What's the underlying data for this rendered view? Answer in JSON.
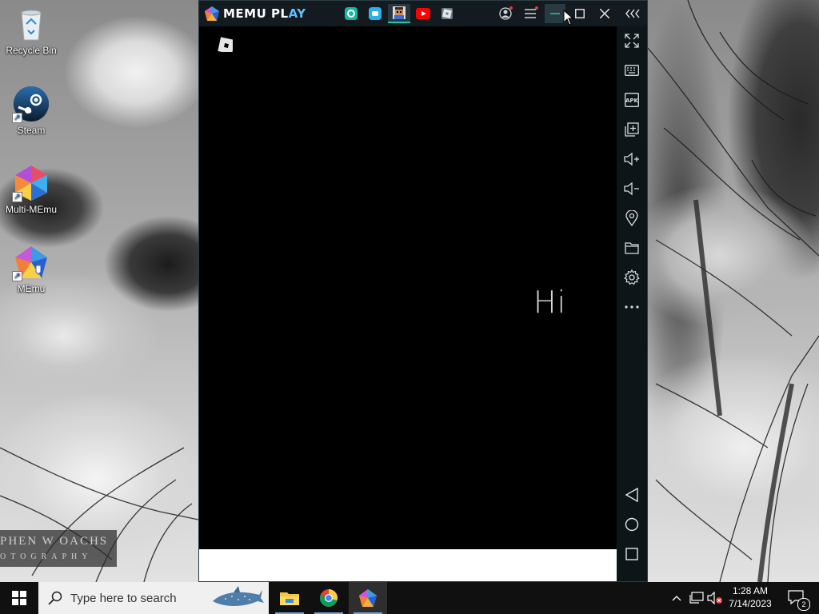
{
  "desktop": {
    "icons": [
      {
        "label": "Recycle Bin",
        "icon": "recycle-bin-icon"
      },
      {
        "label": "Steam",
        "icon": "steam-icon"
      },
      {
        "label": "Multi-MEmu",
        "icon": "multi-memu-icon"
      },
      {
        "label": "MEmu",
        "icon": "memu-icon"
      }
    ],
    "watermark": {
      "line1": "PHEN W OACHS",
      "line2": "OTOGRAPHY"
    }
  },
  "memu": {
    "brand": {
      "part1": "MEMU PL",
      "part2": "AY"
    },
    "app_tabs": [
      {
        "icon": "app-teal-icon",
        "color": "#18b7a0"
      },
      {
        "icon": "app-chat-icon",
        "color": "#2bb3e8"
      },
      {
        "icon": "app-avatar-icon",
        "color": "#c88b5a"
      },
      {
        "icon": "youtube-icon",
        "color": "#ff0000"
      },
      {
        "icon": "roblox-icon",
        "color": "#e6e6e6"
      }
    ],
    "screen": {
      "text": "Hi"
    },
    "sidebar_tools": [
      "fullscreen-icon",
      "keyboard-icon",
      "apk-icon",
      "multi-window-icon",
      "volume-up-icon",
      "volume-down-icon",
      "location-icon",
      "folder-icon",
      "settings-icon",
      "more-icon"
    ],
    "nav_buttons": [
      "back-icon",
      "home-icon",
      "recents-icon"
    ],
    "accent": "#1ec8a5"
  },
  "taskbar": {
    "search_placeholder": "Type here to search",
    "apps": [
      "file-explorer-icon",
      "chrome-icon",
      "memu-icon"
    ],
    "clock": {
      "time": "1:28 AM",
      "date": "7/14/2023"
    },
    "notifications_count": "2"
  }
}
